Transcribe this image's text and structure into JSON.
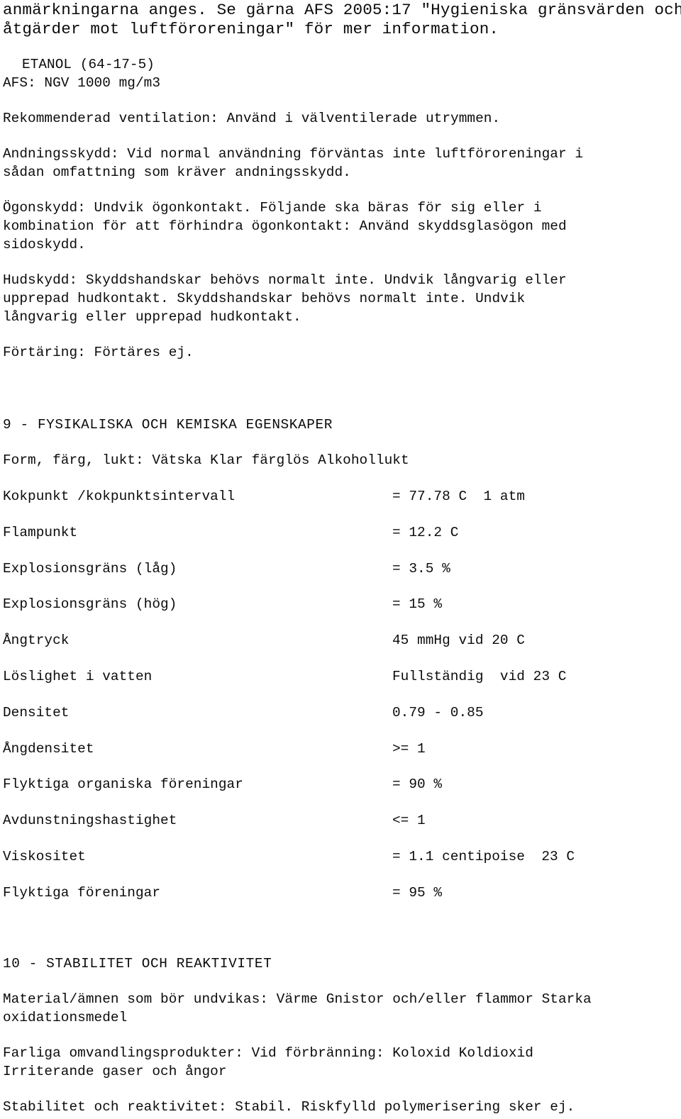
{
  "document": {
    "language": "sv",
    "kind": "safety-data-sheet-page",
    "text_color": "#0b0b0b",
    "background_color": "#ffffff"
  },
  "continued_paragraph": {
    "lines": [
      "anmärkningarna anges. Se gärna AFS 2005:17 \"Hygieniska gränsvärden och",
      "åtgärder mot luftföroreningar\" för mer information."
    ]
  },
  "substance_entry": {
    "name_line": "ETANOL (64-17-5)",
    "limit_line": "AFS: NGV 1000 mg/m3"
  },
  "protection": {
    "ventilation": {
      "lines": [
        "Rekommenderad ventilation: Använd i välventilerade utrymmen."
      ]
    },
    "respiratory": {
      "lines": [
        "Andningsskydd: Vid normal användning förväntas inte luftföroreningar i",
        "sådan omfattning som kräver andningsskydd."
      ]
    },
    "eye": {
      "lines": [
        "Ögonskydd: Undvik ögonkontakt. Följande ska bäras för sig eller i",
        "kombination för att förhindra ögonkontakt: Använd skyddsglasögon med",
        "sidoskydd."
      ]
    },
    "skin": {
      "lines": [
        "Hudskydd: Skyddshandskar behövs normalt inte. Undvik långvarig eller",
        "upprepad hudkontakt. Skyddshandskar behövs normalt inte. Undvik",
        "långvarig eller upprepad hudkontakt."
      ]
    },
    "ingestion": {
      "lines": [
        "Förtäring: Förtäres ej."
      ]
    }
  },
  "section9": {
    "heading": "9 - FYSIKALISKA OCH KEMISKA EGENSKAPER",
    "appearance": "Form, färg, lukt: Vätska Klar färglös Alkohollukt",
    "properties": [
      {
        "label": "Kokpunkt /kokpunktsintervall",
        "value": "= 77.78 C  1 atm"
      },
      {
        "label": "Flampunkt",
        "value": "= 12.2 C"
      },
      {
        "label": "Explosionsgräns (låg)",
        "value": "= 3.5 %"
      },
      {
        "label": "Explosionsgräns (hög)",
        "value": "= 15 %"
      },
      {
        "label": "Ångtryck",
        "value": "45 mmHg vid 20 C"
      },
      {
        "label": "Löslighet i vatten",
        "value": "Fullständig  vid 23 C"
      },
      {
        "label": "Densitet",
        "value": "0.79 - 0.85"
      },
      {
        "label": "Ångdensitet",
        "value": ">= 1"
      },
      {
        "label": "Flyktiga organiska föreningar",
        "value": "= 90 %"
      },
      {
        "label": "Avdunstningshastighet",
        "value": "<= 1"
      },
      {
        "label": "Viskositet",
        "value": "= 1.1 centipoise  23 C"
      },
      {
        "label": "Flyktiga föreningar",
        "value": "= 95 %"
      }
    ]
  },
  "section10": {
    "heading": "10 - STABILITET OCH REAKTIVITET",
    "materials_to_avoid": {
      "lines": [
        "Material/ämnen som bör undvikas: Värme Gnistor och/eller flammor Starka",
        "oxidationsmedel"
      ]
    },
    "hazardous_decomposition": {
      "lines": [
        "Farliga omvandlingsprodukter: Vid förbränning: Koloxid Koldioxid",
        "Irriterande gaser och ångor"
      ]
    },
    "stability": {
      "lines": [
        "Stabilitet och reaktivitet: Stabil. Riskfylld polymerisering sker ej."
      ]
    }
  },
  "layout": {
    "y": {
      "cont_l1": 2,
      "cont_l2": 29,
      "etanol": 79,
      "afs": 105,
      "ventilation": 155,
      "resp_l1": 205,
      "resp_l2": 231,
      "eye_l1": 281,
      "eye_l2": 307,
      "eye_l3": 333,
      "skin_l1": 383,
      "skin_l2": 409,
      "skin_l3": 435,
      "ingestion": 485,
      "s9_heading": 587,
      "s9_appearance": 637,
      "prop_start": 688,
      "prop_step": 50.8,
      "s10_heading": 1347,
      "avoid_l1": 1397,
      "avoid_l2": 1423,
      "decomp_l1": 1473,
      "decomp_l2": 1499,
      "stability": 1549
    }
  }
}
